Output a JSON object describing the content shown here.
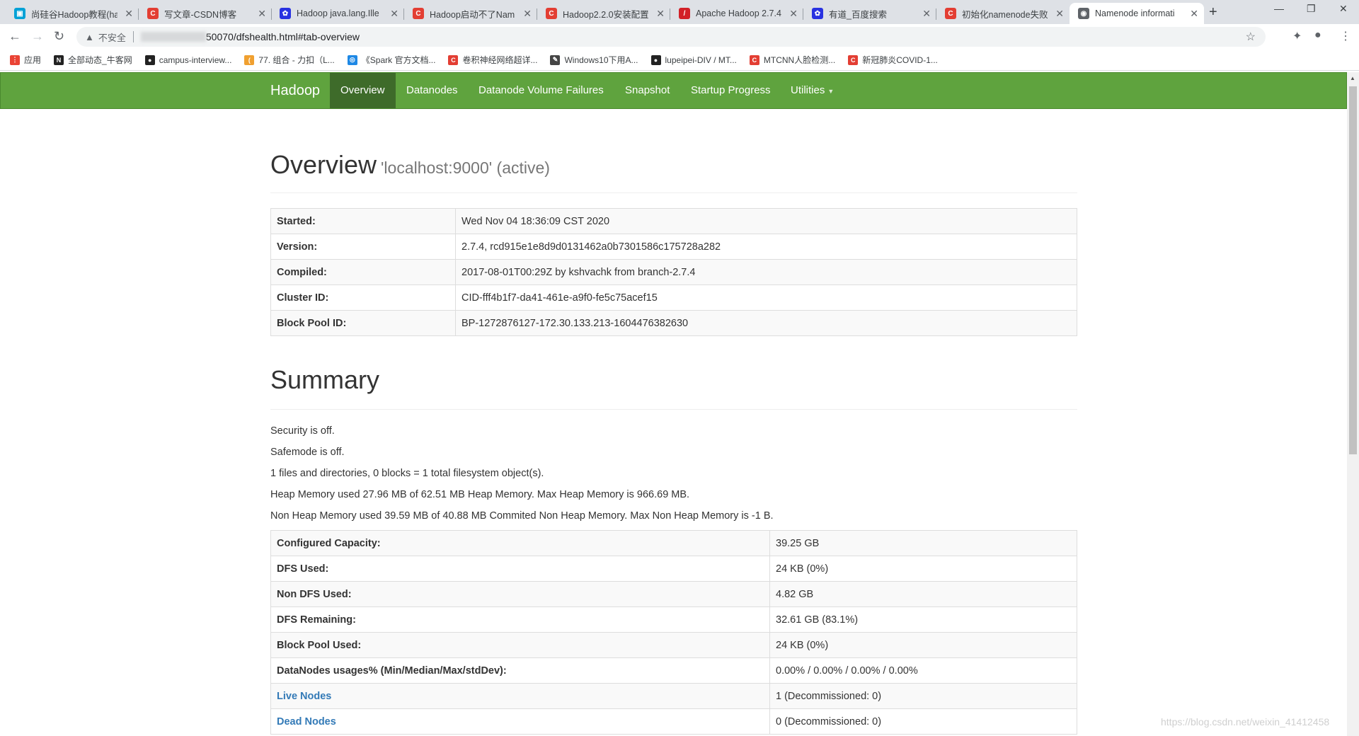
{
  "browser": {
    "tabs": [
      {
        "title": "尚硅谷Hadoop教程(ha",
        "favicon": "bilibili-icon",
        "color": "#00a1d6",
        "glyph": "▣"
      },
      {
        "title": "写文章-CSDN博客",
        "favicon": "csdn-icon",
        "color": "#e33e33",
        "glyph": "C"
      },
      {
        "title": "Hadoop java.lang.Ille",
        "favicon": "baidu-icon",
        "color": "#2932e1",
        "glyph": "✿"
      },
      {
        "title": "Hadoop启动不了Nam",
        "favicon": "csdn-icon",
        "color": "#e33e33",
        "glyph": "C"
      },
      {
        "title": "Hadoop2.2.0安装配置",
        "favicon": "csdn-icon",
        "color": "#e33e33",
        "glyph": "C"
      },
      {
        "title": "Apache Hadoop 2.7.4",
        "favicon": "apache-feather-icon",
        "color": "#d22128",
        "glyph": "/"
      },
      {
        "title": "有道_百度搜索",
        "favicon": "baidu-icon",
        "color": "#2932e1",
        "glyph": "✿"
      },
      {
        "title": "初始化namenode失败",
        "favicon": "csdn-icon",
        "color": "#e33e33",
        "glyph": "C"
      },
      {
        "title": "Namenode informati",
        "favicon": "globe-icon",
        "color": "#5f6368",
        "glyph": "◉"
      }
    ],
    "insecure_label": "不安全",
    "url": "50070/dfshealth.html#tab-overview",
    "bookmarks": [
      {
        "label": "应用",
        "color": "#ea4335",
        "glyph": "⋮"
      },
      {
        "label": "全部动态_牛客网",
        "color": "#222",
        "glyph": "N"
      },
      {
        "label": "campus-interview...",
        "color": "#222",
        "glyph": "●"
      },
      {
        "label": "77. 组合 - 力扣（L...",
        "color": "#f0a030",
        "glyph": "("
      },
      {
        "label": "《Spark 官方文档...",
        "color": "#1e88e5",
        "glyph": "◎"
      },
      {
        "label": "卷积神经网络超详...",
        "color": "#e33e33",
        "glyph": "C"
      },
      {
        "label": "Windows10下用A...",
        "color": "#444",
        "glyph": "✎"
      },
      {
        "label": "lupeipei-DIV / MT...",
        "color": "#222",
        "glyph": "●"
      },
      {
        "label": "MTCNN人脸检测...",
        "color": "#e33e33",
        "glyph": "C"
      },
      {
        "label": "新冠肺炎COVID-1...",
        "color": "#e33e33",
        "glyph": "C"
      }
    ]
  },
  "nav": {
    "brand": "Hadoop",
    "items": [
      "Overview",
      "Datanodes",
      "Datanode Volume Failures",
      "Snapshot",
      "Startup Progress",
      "Utilities"
    ],
    "active": "Overview",
    "accent": "#5fa33e"
  },
  "overview": {
    "title": "Overview",
    "subtitle": "'localhost:9000' (active)",
    "rows": [
      {
        "k": "Started:",
        "v": "Wed Nov 04 18:36:09 CST 2020"
      },
      {
        "k": "Version:",
        "v": "2.7.4, rcd915e1e8d9d0131462a0b7301586c175728a282"
      },
      {
        "k": "Compiled:",
        "v": "2017-08-01T00:29Z by kshvachk from branch-2.7.4"
      },
      {
        "k": "Cluster ID:",
        "v": "CID-fff4b1f7-da41-461e-a9f0-fe5c75acef15"
      },
      {
        "k": "Block Pool ID:",
        "v": "BP-1272876127-172.30.133.213-1604476382630"
      }
    ]
  },
  "summary": {
    "title": "Summary",
    "lines": [
      "Security is off.",
      "Safemode is off.",
      "1 files and directories, 0 blocks = 1 total filesystem object(s).",
      "Heap Memory used 27.96 MB of 62.51 MB Heap Memory. Max Heap Memory is 966.69 MB.",
      "Non Heap Memory used 39.59 MB of 40.88 MB Commited Non Heap Memory. Max Non Heap Memory is -1 B."
    ],
    "rows": [
      {
        "k": "Configured Capacity:",
        "v": "39.25 GB"
      },
      {
        "k": "DFS Used:",
        "v": "24 KB (0%)"
      },
      {
        "k": "Non DFS Used:",
        "v": "4.82 GB"
      },
      {
        "k": "DFS Remaining:",
        "v": "32.61 GB (83.1%)"
      },
      {
        "k": "Block Pool Used:",
        "v": "24 KB (0%)"
      },
      {
        "k": "DataNodes usages% (Min/Median/Max/stdDev):",
        "v": "0.00% / 0.00% / 0.00% / 0.00%"
      },
      {
        "k": "Live Nodes",
        "v": "1 (Decommissioned: 0)",
        "link": true
      },
      {
        "k": "Dead Nodes",
        "v": "0 (Decommissioned: 0)",
        "link": true
      }
    ]
  },
  "watermark": "https://blog.csdn.net/weixin_41412458"
}
